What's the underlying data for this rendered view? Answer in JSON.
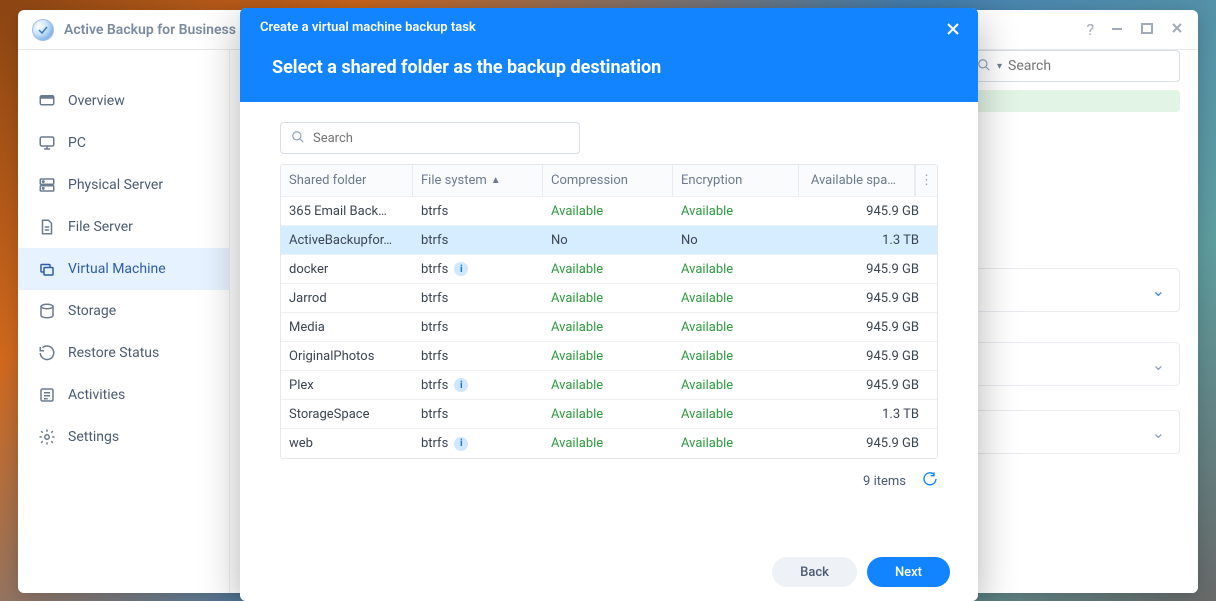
{
  "app": {
    "title": "Active Backup for Business"
  },
  "sidebar": {
    "items": [
      {
        "label": "Overview"
      },
      {
        "label": "PC"
      },
      {
        "label": "Physical Server"
      },
      {
        "label": "File Server"
      },
      {
        "label": "Virtual Machine"
      },
      {
        "label": "Storage"
      },
      {
        "label": "Restore Status"
      },
      {
        "label": "Activities"
      },
      {
        "label": "Settings"
      }
    ]
  },
  "bg_search": {
    "placeholder": "Search"
  },
  "modal": {
    "title": "Create a virtual machine backup task",
    "subtitle": "Select a shared folder as the backup destination",
    "search": {
      "placeholder": "Search"
    },
    "table": {
      "columns": {
        "folder": "Shared folder",
        "fs": "File system",
        "compression": "Compression",
        "encryption": "Encryption",
        "space": "Available spa…"
      },
      "rows": [
        {
          "folder": "365 Email Back…",
          "fs": "btrfs",
          "info": false,
          "compression": "Available",
          "encryption": "Available",
          "space": "945.9 GB",
          "selected": false
        },
        {
          "folder": "ActiveBackupfor…",
          "fs": "btrfs",
          "info": false,
          "compression": "No",
          "encryption": "No",
          "space": "1.3 TB",
          "selected": true
        },
        {
          "folder": "docker",
          "fs": "btrfs",
          "info": true,
          "compression": "Available",
          "encryption": "Available",
          "space": "945.9 GB",
          "selected": false
        },
        {
          "folder": "Jarrod",
          "fs": "btrfs",
          "info": false,
          "compression": "Available",
          "encryption": "Available",
          "space": "945.9 GB",
          "selected": false
        },
        {
          "folder": "Media",
          "fs": "btrfs",
          "info": false,
          "compression": "Available",
          "encryption": "Available",
          "space": "945.9 GB",
          "selected": false
        },
        {
          "folder": "OriginalPhotos",
          "fs": "btrfs",
          "info": false,
          "compression": "Available",
          "encryption": "Available",
          "space": "945.9 GB",
          "selected": false
        },
        {
          "folder": "Plex",
          "fs": "btrfs",
          "info": true,
          "compression": "Available",
          "encryption": "Available",
          "space": "945.9 GB",
          "selected": false
        },
        {
          "folder": "StorageSpace",
          "fs": "btrfs",
          "info": false,
          "compression": "Available",
          "encryption": "Available",
          "space": "1.3 TB",
          "selected": false
        },
        {
          "folder": "web",
          "fs": "btrfs",
          "info": true,
          "compression": "Available",
          "encryption": "Available",
          "space": "945.9 GB",
          "selected": false
        }
      ],
      "footer": "9 items"
    },
    "buttons": {
      "back": "Back",
      "next": "Next"
    }
  }
}
